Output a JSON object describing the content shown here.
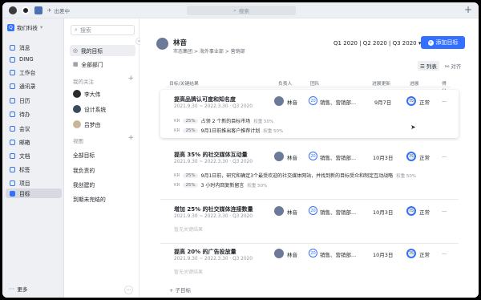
{
  "titlebar": {
    "tab_label": "出差中",
    "search_placeholder": "搜索",
    "plus": "+"
  },
  "nav": {
    "brand": "我们科技",
    "items": [
      {
        "label": "消息"
      },
      {
        "label": "DING"
      },
      {
        "label": "工作台"
      },
      {
        "label": "通讯录"
      },
      {
        "label": "日历"
      },
      {
        "label": "待办"
      },
      {
        "label": "会议"
      },
      {
        "label": "邮箱"
      },
      {
        "label": "文档"
      },
      {
        "label": "标签"
      },
      {
        "label": "项目"
      },
      {
        "label": "目标"
      }
    ],
    "more_label": "更多"
  },
  "panel": {
    "search_placeholder": "搜索",
    "my_goals": "我的目标",
    "all_depts": "全部部门",
    "follow_section": "我的关注",
    "follow": [
      {
        "label": "李大伟"
      },
      {
        "label": "设计系统"
      },
      {
        "label": "吕梦由"
      }
    ],
    "view_section": "视图",
    "views": [
      "全部目标",
      "我负责的",
      "我创建的",
      "到期未完结的"
    ]
  },
  "main": {
    "owner_name": "林音",
    "owner_dept": "市态集团 > 海外事业部 > 营销部",
    "quarters": "Q1 2020 | Q2 2020 | Q3 2020 ▾",
    "add_button": "添加目标",
    "view_list": "列表",
    "view_align": "对齐",
    "columns": {
      "goal": "目标/关键结果",
      "owner": "负责人",
      "team": "团队",
      "updated": "进展更新",
      "progress": "进展",
      "score": "得分"
    },
    "objectives": [
      {
        "title": "提高品牌认可度和知名度",
        "period": "2021.9.30 ~ 2022.3.30 · Q3 2020",
        "owner": "林音",
        "team_count": "20",
        "team": "销售、营销部...",
        "updated": "9月7日",
        "progress": "75",
        "status": "正常",
        "score": "—",
        "krs": [
          {
            "tag": "KR",
            "pct": "25%",
            "text": "占领 2 个新的目标市场",
            "weight": "权重 50%"
          },
          {
            "tag": "KR",
            "pct": "25%",
            "text": "9月1日前推出客户推荐计划",
            "weight": "权重 50%"
          }
        ]
      },
      {
        "title": "提高 35% 的社交媒体互动量",
        "period": "2021.9.30 ~ 2022.3.30 · Q3 2020",
        "owner": "林音",
        "team_count": "20",
        "team": "销售、营销部...",
        "updated": "10月3日",
        "progress": "75",
        "status": "正常",
        "score": "—",
        "krs": [
          {
            "tag": "KR",
            "pct": "25%",
            "text": "9月1日前，研究和确定3个最受欢迎的社交媒体网站，并找到新的目标受众和制定互动战略",
            "weight": "权重 50%"
          },
          {
            "tag": "KR",
            "pct": "25%",
            "text": "3 小时内回复新留言",
            "weight": "权重 50%"
          }
        ]
      },
      {
        "title": "增加 25% 的社交媒体连接数量",
        "period": "2021.9.30 ~ 2022.3.30 · Q3 2020",
        "owner": "林音",
        "team_count": "20",
        "team": "销售、营销部...",
        "updated": "10月3日",
        "progress": "75",
        "status": "正常",
        "score": "—",
        "no_kr": "暂无关键结果"
      },
      {
        "title": "提高 20% 的广告投放量",
        "period": "2021.9.30 ~ 2022.3.30 · Q3 2020",
        "owner": "林音",
        "team_count": "20",
        "team": "销售、营销部...",
        "updated": "10月3日",
        "progress": "75",
        "status": "正常",
        "score": "—",
        "no_kr": "暂无关键结果"
      }
    ],
    "add_child": "+ 子目标"
  },
  "colors": {
    "accent": "#3370ff",
    "nav_bg": "#eef0f3",
    "titlebar_bg": "#eceff3"
  }
}
